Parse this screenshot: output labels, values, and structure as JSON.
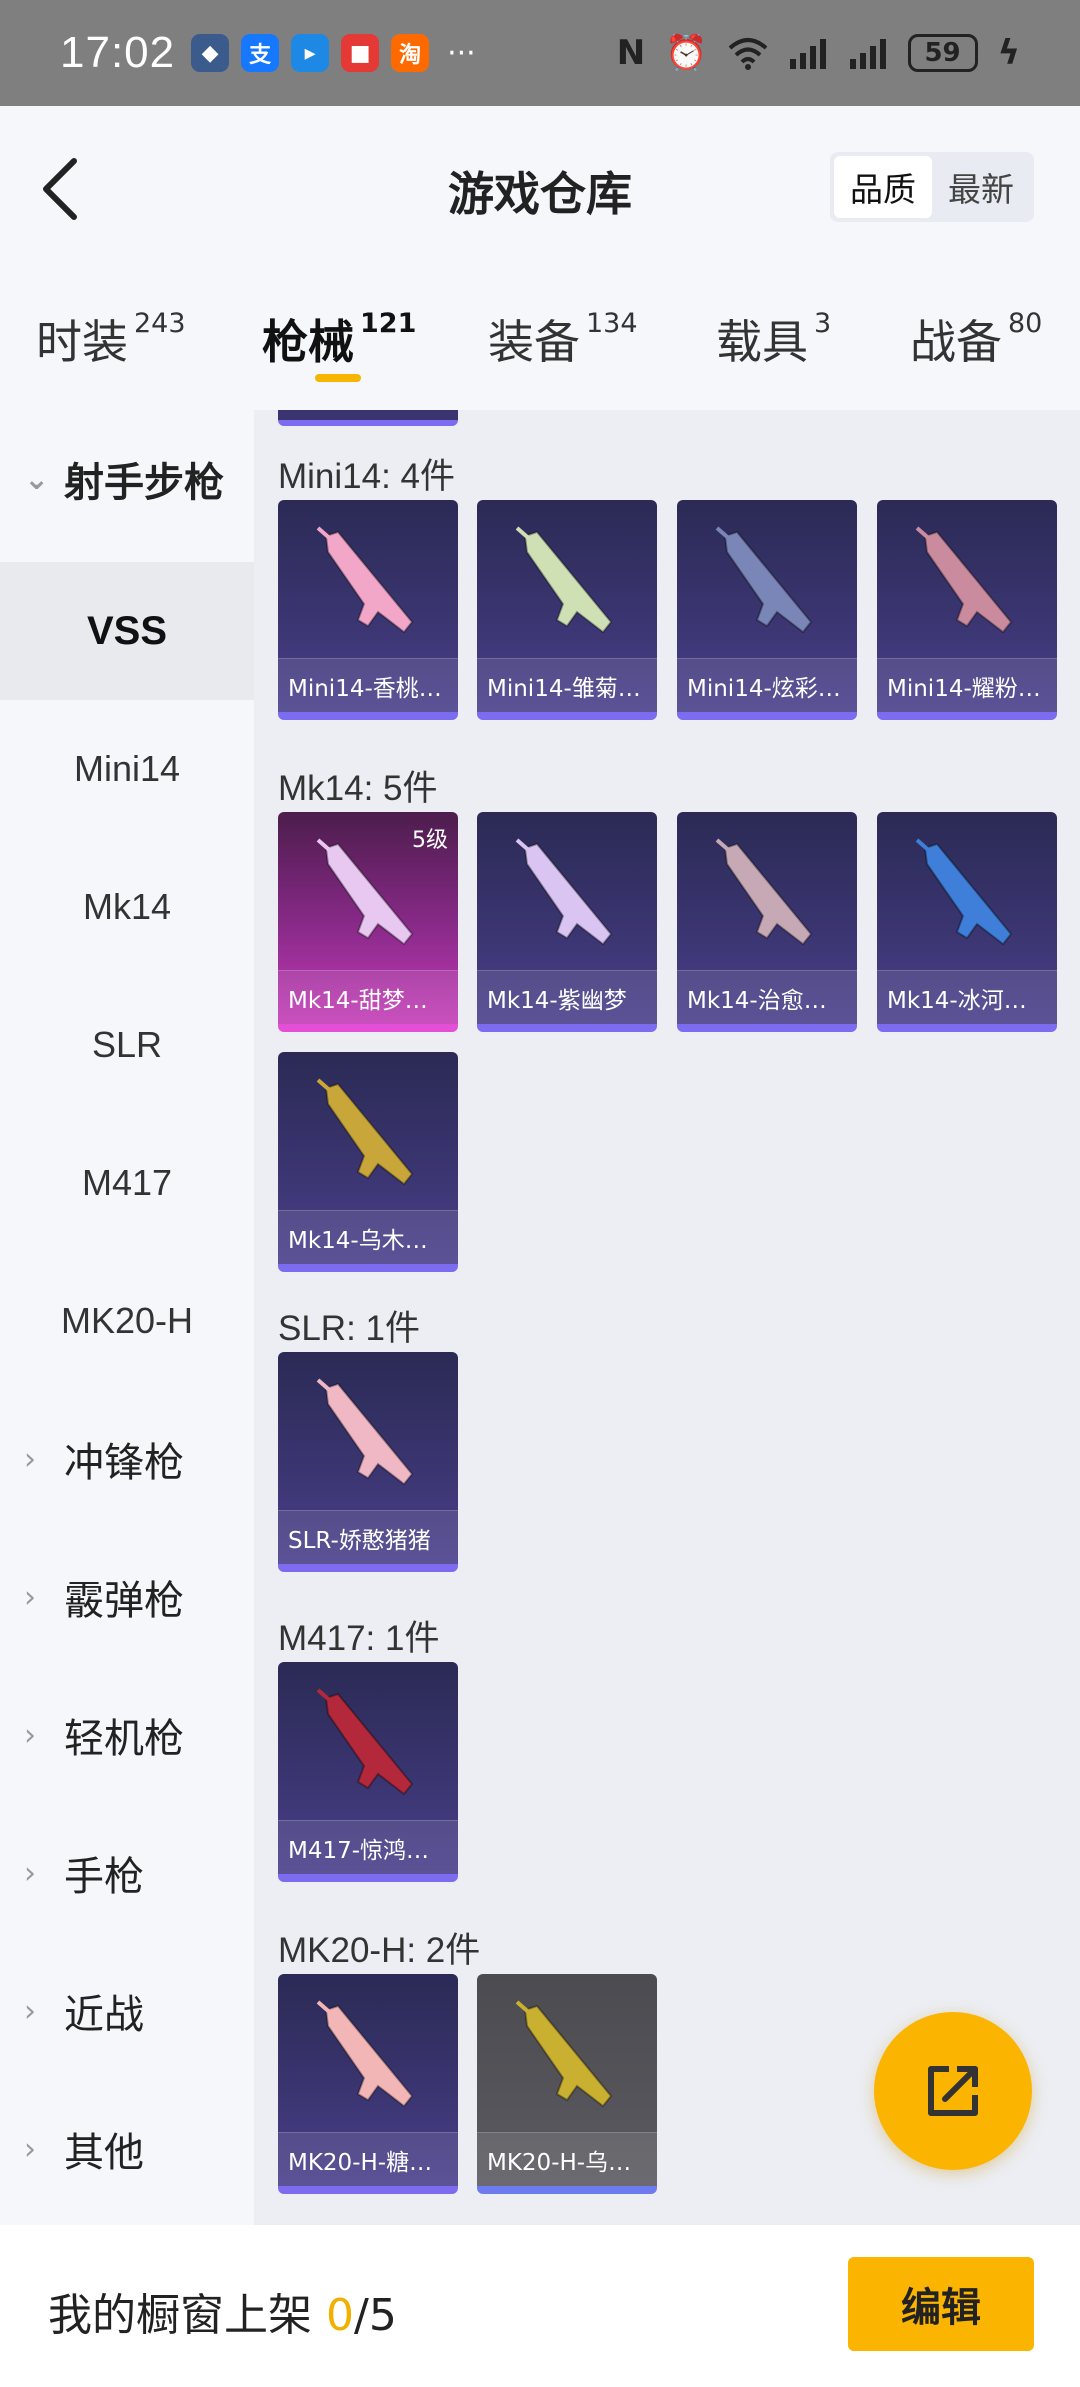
{
  "status_bar": {
    "time": "17:02",
    "apps": [
      {
        "label": "支",
        "color": "#1677ff"
      },
      {
        "label": "▸",
        "color": "#1e88e5"
      },
      {
        "label": "■",
        "color": "#e53935"
      },
      {
        "label": "淘",
        "color": "#ff6a00"
      }
    ],
    "more": "···",
    "battery": "59"
  },
  "header": {
    "title": "游戏仓库",
    "sort_options": [
      "品质",
      "最新"
    ],
    "sort_active": "品质"
  },
  "tabs": [
    {
      "label": "时装",
      "count": "243"
    },
    {
      "label": "枪械",
      "count": "121",
      "active": true
    },
    {
      "label": "装备",
      "count": "134"
    },
    {
      "label": "载具",
      "count": "3"
    },
    {
      "label": "战备",
      "count": "80"
    }
  ],
  "sidebar": {
    "group_open": "射手步枪",
    "subitems": [
      "VSS",
      "Mini14",
      "Mk14",
      "SLR",
      "M417",
      "MK20-H"
    ],
    "active_sub": "VSS",
    "groups": [
      "冲锋枪",
      "霰弹枪",
      "轻机枪",
      "手枪",
      "近战",
      "其他"
    ]
  },
  "sections": [
    {
      "title": "Mini14: 4件",
      "items": [
        {
          "name": "Mini14-香桃…",
          "gun": "#f2a6c8",
          "variant": "purple"
        },
        {
          "name": "Mini14-雏菊…",
          "gun": "#cfe0b5",
          "variant": "purple"
        },
        {
          "name": "Mini14-炫彩…",
          "gun": "#7a86b8",
          "variant": "purple"
        },
        {
          "name": "Mini14-耀粉…",
          "gun": "#c98b9d",
          "variant": "purple"
        }
      ]
    },
    {
      "title": "Mk14: 5件",
      "items": [
        {
          "name": "Mk14-甜梦…",
          "gun": "#e8c8f0",
          "variant": "pink",
          "level": "5级"
        },
        {
          "name": "Mk14-紫幽梦",
          "gun": "#d9c4f2",
          "variant": "purple"
        },
        {
          "name": "Mk14-治愈…",
          "gun": "#c7a9b5",
          "variant": "purple"
        },
        {
          "name": "Mk14-冰河…",
          "gun": "#3f7fd9",
          "variant": "purple"
        },
        {
          "name": "Mk14-乌木…",
          "gun": "#c9a63a",
          "variant": "purple"
        }
      ]
    },
    {
      "title": "SLR: 1件",
      "items": [
        {
          "name": "SLR-娇憨猪猪",
          "gun": "#f0b8c4",
          "variant": "purple"
        }
      ]
    },
    {
      "title": "M417: 1件",
      "items": [
        {
          "name": "M417-惊鸿…",
          "gun": "#b3283a",
          "variant": "purple"
        }
      ]
    },
    {
      "title": "MK20-H: 2件",
      "items": [
        {
          "name": "MK20-H-糖…",
          "gun": "#f2b6b6",
          "variant": "purple"
        },
        {
          "name": "MK20-H-乌…",
          "gun": "#c9b030",
          "variant": "grey"
        }
      ]
    }
  ],
  "bottom": {
    "shelf_prefix": "我的橱窗上架 ",
    "shelf_used": "0",
    "shelf_total": "/5",
    "edit_label": "编辑"
  },
  "colors": {
    "accent": "#fbb400",
    "card_purple": "#3a3570",
    "card_pink": "#c43cb8"
  }
}
